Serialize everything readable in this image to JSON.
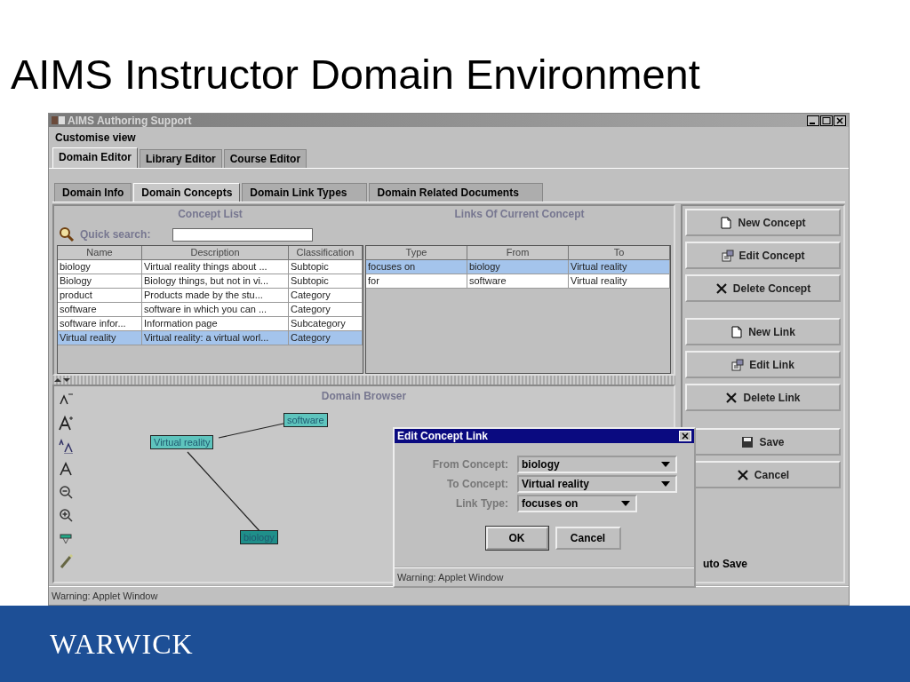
{
  "slide_title": "AIMS Instructor Domain Environment",
  "window": {
    "title": "AIMS Authoring Support"
  },
  "menu": [
    "Customise view"
  ],
  "tabs": [
    {
      "label": "Domain Editor",
      "selected": true
    },
    {
      "label": "Library Editor",
      "selected": false
    },
    {
      "label": "Course Editor",
      "selected": false
    }
  ],
  "subtabs": [
    {
      "label": "Domain Info",
      "selected": false
    },
    {
      "label": "Domain Concepts",
      "selected": true
    },
    {
      "label": "Domain Link Types",
      "selected": false
    },
    {
      "label": "Domain Related Documents",
      "selected": false
    }
  ],
  "concept_list": {
    "title": "Concept List",
    "search_label": "Quick search:",
    "columns": [
      "Name",
      "Description",
      "Classification"
    ],
    "rows": [
      {
        "cells": [
          "biology",
          "Virtual reality things about ...",
          "Subtopic"
        ],
        "selected": false
      },
      {
        "cells": [
          "Biology",
          "Biology things, but not in vi...",
          "Subtopic"
        ],
        "selected": false
      },
      {
        "cells": [
          "product",
          "Products made by the stu...",
          "Category"
        ],
        "selected": false
      },
      {
        "cells": [
          "software",
          "software in which you can ...",
          "Category"
        ],
        "selected": false
      },
      {
        "cells": [
          "software infor...",
          "Information page",
          "Subcategory"
        ],
        "selected": false
      },
      {
        "cells": [
          "Virtual reality",
          "Virtual reality: a virtual worl...",
          "Category"
        ],
        "selected": true
      }
    ]
  },
  "links": {
    "title": "Links Of Current Concept",
    "columns": [
      "Type",
      "From",
      "To"
    ],
    "rows": [
      {
        "cells": [
          "focuses on",
          "biology",
          "Virtual reality"
        ],
        "selected": true
      },
      {
        "cells": [
          "for",
          "software",
          "Virtual reality"
        ],
        "selected": false
      }
    ]
  },
  "domain_browser": {
    "title": "Domain Browser",
    "nodes": [
      {
        "label": "software",
        "color": "#5ec4bd"
      },
      {
        "label": "Virtual reality",
        "color": "#5ec4bd"
      },
      {
        "label": "biology",
        "color": "#1f8f8a"
      }
    ]
  },
  "button_groups": [
    [
      {
        "label": "New Concept",
        "kind": "new"
      },
      {
        "label": "Edit Concept",
        "kind": "edit"
      },
      {
        "label": "Delete Concept",
        "kind": "delete"
      }
    ],
    [
      {
        "label": "New Link",
        "kind": "new"
      },
      {
        "label": "Edit Link",
        "kind": "edit"
      },
      {
        "label": "Delete Link",
        "kind": "delete"
      }
    ],
    [
      {
        "label": "Save",
        "kind": "save"
      },
      {
        "label": "Cancel",
        "kind": "delete"
      }
    ]
  ],
  "auto_save": "uto Save",
  "dialog": {
    "title": "Edit Concept Link",
    "fields": [
      {
        "label": "From Concept:",
        "value": "biology",
        "kind": "wide"
      },
      {
        "label": "To Concept:",
        "value": "Virtual reality",
        "kind": "wide"
      },
      {
        "label": "Link Type:",
        "value": "focuses on",
        "kind": "narrow"
      }
    ],
    "buttons": [
      "OK",
      "Cancel"
    ],
    "status": "Warning: Applet Window"
  },
  "status_bar": "Warning: Applet Window",
  "footer_logo": "WARWICK"
}
